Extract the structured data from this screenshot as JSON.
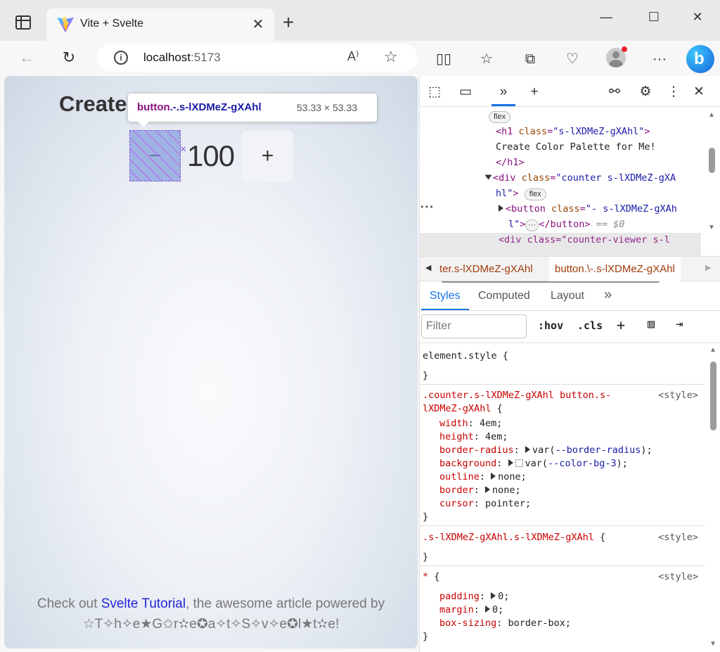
{
  "browser": {
    "tab_title": "Vite + Svelte",
    "url_host": "localhost",
    "url_port": ":5173"
  },
  "page": {
    "heading": "Create",
    "minus_label": "−",
    "plus_label": "+",
    "counter_value": "100",
    "footer_prefix": "Check out ",
    "footer_link": "Svelte Tutorial",
    "footer_suffix": ", the awesome article powered by",
    "footer_line2": "☆T✧h✧e★G✩r✫e✪a✧t✧S✧v✧e✪l★t✫e!"
  },
  "inspect_tooltip": {
    "tag": "button",
    "class_text": ".-.s-lXDMeZ-gXAhl",
    "size": "53.33 × 53.33"
  },
  "devtools": {
    "dom": {
      "flex_pill": "flex",
      "h1_open": "<h1 ",
      "h1_attr": "class",
      "h1_val": "\"s-lXDMeZ-gXAhl\"",
      "h1_close": ">",
      "h1_text": "Create Color Palette for Me!",
      "h1_end": "</h1>",
      "div_open": "<div ",
      "div_attr": "class",
      "div_val": "\"counter s-lXDMeZ-gXA",
      "div_val2": "hl\"",
      "div_close": ">",
      "btn_open": "<button ",
      "btn_attr": "class",
      "btn_val": "\"- s-lXDMeZ-gXAh",
      "btn_val2": "l\"",
      "btn_mid": ">",
      "btn_dots": "···",
      "btn_end": "</button>",
      "btn_dollar": " == $0",
      "next_line": "<div class=\"counter-viewer s-l",
      "row_dots": "•••"
    },
    "breadcrumbs": [
      "ter.s-lXDMeZ-gXAhl",
      "button.\\-.s-lXDMeZ-gXAhl"
    ],
    "tabs": [
      "Styles",
      "Computed",
      "Layout"
    ],
    "filter_placeholder": "Filter",
    "hov": ":hov",
    "cls": ".cls",
    "rules": {
      "element_style": "element.style {",
      "close_brace": "}",
      "rule1_sel1": ".counter.s-lXDMeZ-gXAhl button.s-",
      "rule1_sel2": "lXDMeZ-gXAhl",
      "open_brace": " {",
      "source": "<style>",
      "r1_props": [
        {
          "name": "width",
          "value": "4em;"
        },
        {
          "name": "height",
          "value": "4em;"
        },
        {
          "name": "border-radius",
          "pre": "var(",
          "var": "--border-radius",
          "post": ");"
        },
        {
          "name": "background",
          "pre": "var(",
          "var": "--color-bg-3",
          "post": ");"
        },
        {
          "name": "outline",
          "value": "none;"
        },
        {
          "name": "border",
          "value": "none;"
        },
        {
          "name": "cursor",
          "value": "pointer;"
        }
      ],
      "rule2_sel": ".s-lXDMeZ-gXAhl.s-lXDMeZ-gXAhl",
      "rule3_sel": "*",
      "r3_props": [
        {
          "name": "padding",
          "value": "0;"
        },
        {
          "name": "margin",
          "value": "0;"
        },
        {
          "name": "box-sizing",
          "value": "border-box;"
        }
      ]
    }
  }
}
